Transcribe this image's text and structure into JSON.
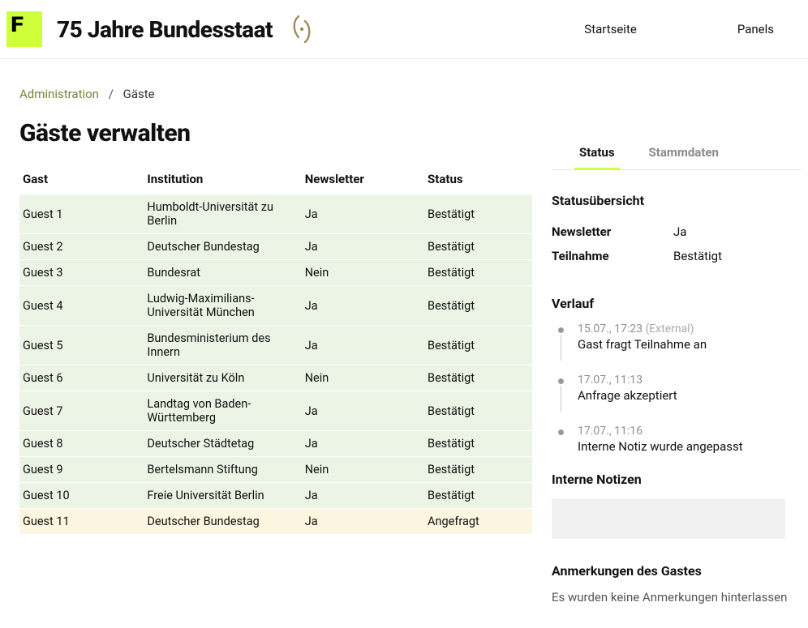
{
  "header": {
    "title": "75 Jahre Bundesstaat",
    "nav": {
      "home": "Startseite",
      "panels": "Panels"
    }
  },
  "breadcrumb": {
    "admin": "Administration",
    "current": "Gäste"
  },
  "page": {
    "title": "Gäste verwalten"
  },
  "table": {
    "headers": {
      "guest": "Gast",
      "institution": "Institution",
      "newsletter": "Newsletter",
      "status": "Status"
    },
    "rows": [
      {
        "guest": "Guest 1",
        "institution": "Humboldt-Universität zu Berlin",
        "newsletter": "Ja",
        "status": "Bestätigt",
        "tone": "green"
      },
      {
        "guest": "Guest 2",
        "institution": "Deutscher Bundestag",
        "newsletter": "Ja",
        "status": "Bestätigt",
        "tone": "green"
      },
      {
        "guest": "Guest 3",
        "institution": "Bundesrat",
        "newsletter": "Nein",
        "status": "Bestätigt",
        "tone": "green"
      },
      {
        "guest": "Guest 4",
        "institution": "Ludwig-Maximilians-Universität München",
        "newsletter": "Ja",
        "status": "Bestätigt",
        "tone": "green"
      },
      {
        "guest": "Guest 5",
        "institution": "Bundesministerium des Innern",
        "newsletter": "Ja",
        "status": "Bestätigt",
        "tone": "green"
      },
      {
        "guest": "Guest 6",
        "institution": "Universität zu Köln",
        "newsletter": "Nein",
        "status": "Bestätigt",
        "tone": "green"
      },
      {
        "guest": "Guest 7",
        "institution": "Landtag von Baden-Württemberg",
        "newsletter": "Ja",
        "status": "Bestätigt",
        "tone": "green"
      },
      {
        "guest": "Guest 8",
        "institution": "Deutscher Städtetag",
        "newsletter": "Ja",
        "status": "Bestätigt",
        "tone": "green"
      },
      {
        "guest": "Guest 9",
        "institution": "Bertelsmann Stiftung",
        "newsletter": "Nein",
        "status": "Bestätigt",
        "tone": "green"
      },
      {
        "guest": "Guest 10",
        "institution": "Freie Universität Berlin",
        "newsletter": "Ja",
        "status": "Bestätigt",
        "tone": "green"
      },
      {
        "guest": "Guest 11",
        "institution": "Deutscher Bundestag",
        "newsletter": "Ja",
        "status": "Angefragt",
        "tone": "cream"
      }
    ]
  },
  "side": {
    "tabs": {
      "status": "Status",
      "stammdaten": "Stammdaten"
    },
    "overview": {
      "heading": "Statusübersicht",
      "newsletter_label": "Newsletter",
      "newsletter_value": "Ja",
      "teilnahme_label": "Teilnahme",
      "teilnahme_value": "Bestätigt"
    },
    "history": {
      "heading": "Verlauf",
      "items": [
        {
          "time": "15.07., 17:23",
          "tag": "(External)",
          "text": "Gast fragt Teilnahme an"
        },
        {
          "time": "17.07., 11:13",
          "tag": "",
          "text": "Anfrage akzeptiert"
        },
        {
          "time": "17.07., 11:16",
          "tag": "",
          "text": "Interne Notiz wurde angepasst"
        }
      ]
    },
    "notes": {
      "heading": "Interne Notizen"
    },
    "remarks": {
      "heading": "Anmerkungen des Gastes",
      "text": "Es wurden keine Anmerkungen hinterlassen"
    }
  }
}
